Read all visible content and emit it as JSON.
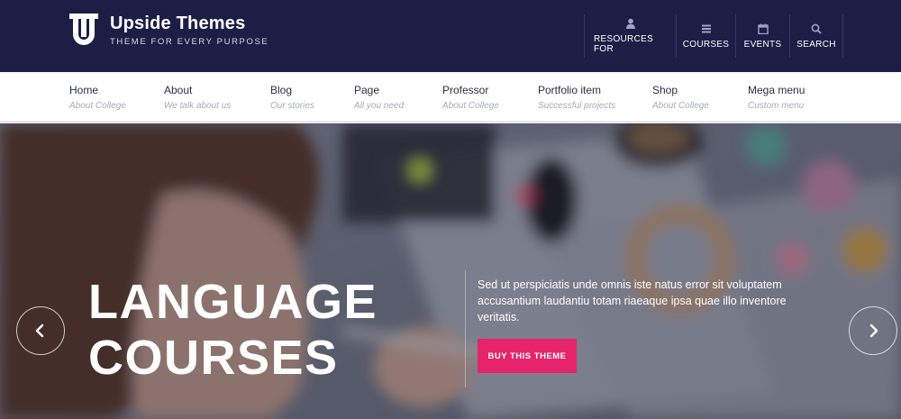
{
  "brand": {
    "title": "Upside Themes",
    "tagline": "THEME FOR EVERY PURPOSE"
  },
  "top_links": [
    {
      "label": "RESOURCES FOR",
      "icon": "user-icon"
    },
    {
      "label": "COURSES",
      "icon": "list-icon"
    },
    {
      "label": "EVENTS",
      "icon": "calendar-icon"
    },
    {
      "label": "SEARCH",
      "icon": "search-icon"
    }
  ],
  "nav": [
    {
      "title": "Home",
      "subtitle": "About College"
    },
    {
      "title": "About",
      "subtitle": "We talk about us"
    },
    {
      "title": "Blog",
      "subtitle": "Our stories"
    },
    {
      "title": "Page",
      "subtitle": "All you need"
    },
    {
      "title": "Professor",
      "subtitle": "About College"
    },
    {
      "title": "Portfolio item",
      "subtitle": "Successful projects"
    },
    {
      "title": "Shop",
      "subtitle": "About College"
    },
    {
      "title": "Mega menu",
      "subtitle": "Custom menu"
    }
  ],
  "hero": {
    "title_line1": "LANGUAGE",
    "title_line2": "COURSES",
    "description": "Sed ut perspiciatis unde omnis iste natus error sit voluptatem accusantium laudantiu totam riaeaque ipsa quae illo inventore veritatis.",
    "button_label": "BUY THIS THEME",
    "prev_icon": "chevron-left-icon",
    "next_icon": "chevron-right-icon"
  },
  "colors": {
    "header_bg": "#1c1e46",
    "accent": "#e5246c",
    "nav_active": "#1f2a59"
  }
}
